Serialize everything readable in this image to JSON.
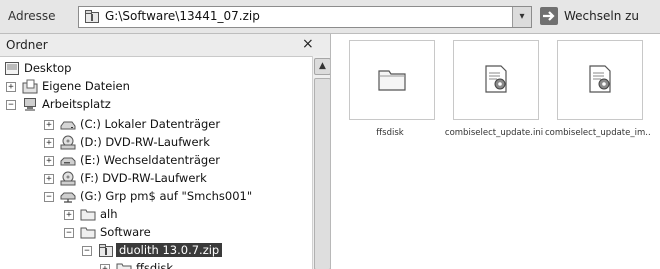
{
  "address": {
    "label": "Adresse",
    "path": "G:\\Software\\13441_07.zip",
    "dropdown_glyph": "▾",
    "go_label": "Wechseln zu"
  },
  "folder_pane": {
    "title": "Ordner",
    "close_glyph": "×",
    "tree": [
      {
        "label": "Desktop",
        "icon": "desktop-icon",
        "expander": ""
      },
      {
        "label": "Eigene Dateien",
        "icon": "documents-folder-icon",
        "expander": "+"
      },
      {
        "label": "Arbeitsplatz",
        "icon": "computer-icon",
        "expander": "−"
      },
      {
        "label": "(C:) Lokaler Datenträger",
        "icon": "hard-disk-icon",
        "expander": "+"
      },
      {
        "label": "(D:) DVD-RW-Laufwerk",
        "icon": "dvd-drive-icon",
        "expander": "+"
      },
      {
        "label": "(E:) Wechseldatenträger",
        "icon": "removable-drive-icon",
        "expander": "+"
      },
      {
        "label": "(F:) DVD-RW-Laufwerk",
        "icon": "dvd-drive-icon",
        "expander": "+"
      },
      {
        "label": "(G:) Grp pm$ auf \"Smchs001\"",
        "icon": "network-drive-icon",
        "expander": "−"
      },
      {
        "label": "alh",
        "icon": "folder-icon",
        "expander": "+"
      },
      {
        "label": "Software",
        "icon": "folder-icon",
        "expander": "−"
      },
      {
        "label": "duolith 13.0.7.zip",
        "icon": "zip-folder-icon",
        "expander": "−",
        "selected": true
      },
      {
        "label": "ffsdisk",
        "icon": "folder-icon",
        "expander": "+"
      }
    ]
  },
  "files": [
    {
      "name": "ffsdisk",
      "icon": "folder-icon"
    },
    {
      "name": "combiselect_update.ini",
      "icon": "settings-file-icon"
    },
    {
      "name": "combiselect_update_im...",
      "icon": "settings-file-icon"
    }
  ]
}
